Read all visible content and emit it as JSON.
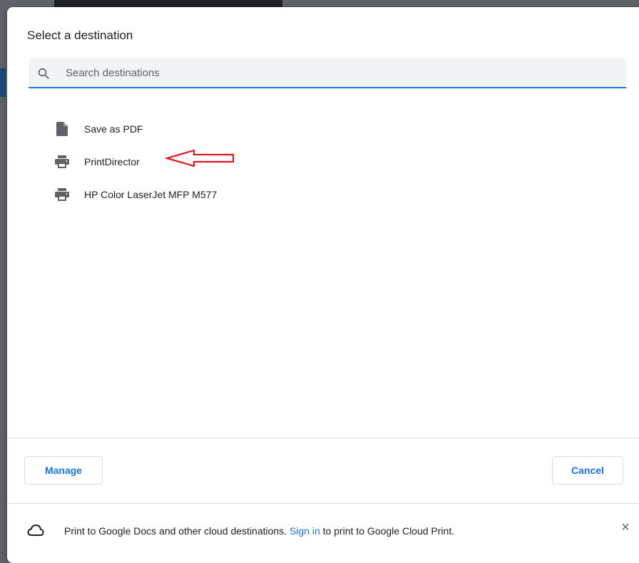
{
  "dialog": {
    "title": "Select a destination"
  },
  "search": {
    "placeholder": "Search destinations",
    "value": ""
  },
  "destinations": [
    {
      "label": "Save as PDF",
      "icon": "pdf-file-icon"
    },
    {
      "label": "PrintDirector",
      "icon": "printer-icon"
    },
    {
      "label": "HP Color LaserJet MFP M577",
      "icon": "printer-icon"
    }
  ],
  "buttons": {
    "manage": "Manage",
    "cancel": "Cancel"
  },
  "footer": {
    "text_before": "Print to Google Docs and other cloud destinations. ",
    "link": "Sign in",
    "text_after": " to print to Google Cloud Print.",
    "close": "×"
  },
  "colors": {
    "accent": "#1a73e8",
    "annotation_arrow": "#e8141b"
  }
}
